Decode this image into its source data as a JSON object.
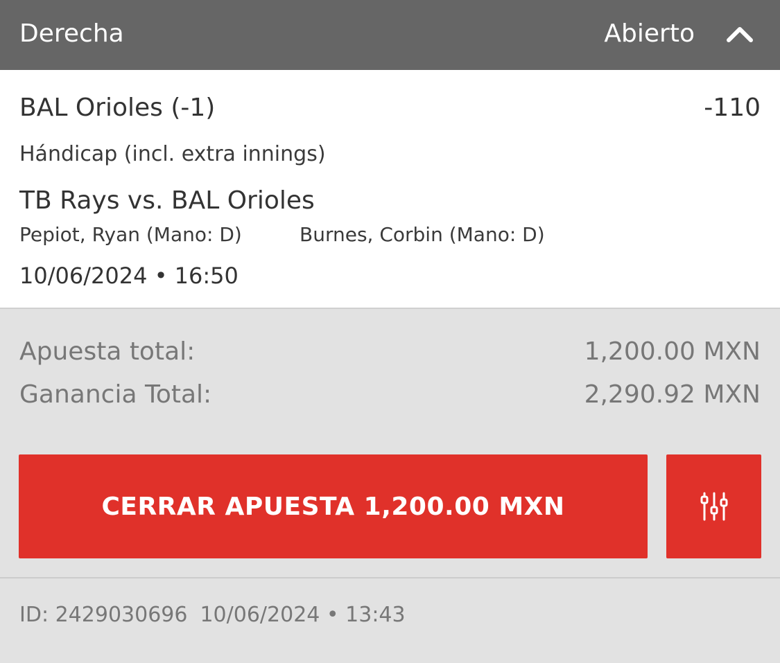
{
  "header": {
    "title": "Derecha",
    "status": "Abierto",
    "toggle_icon": "chevron-up-icon",
    "background": "#666666"
  },
  "selection": {
    "name": "BAL Orioles (-1)",
    "odds": "-110",
    "market": "Hándicap (incl. extra innings)",
    "event": "TB Rays vs. BAL Orioles",
    "pitcher_home": "Pepiot, Ryan (Mano: D)",
    "pitcher_away": "Burnes, Corbin (Mano: D)",
    "event_datetime": "10/06/2024 • 16:50"
  },
  "summary": {
    "stake_label": "Apuesta total:",
    "stake_value": "1,200.00 MXN",
    "win_label": "Ganancia Total:",
    "win_value": "2,290.92 MXN"
  },
  "actions": {
    "cashout_label": "CERRAR APUESTA 1,200.00 MXN",
    "settings_icon": "sliders-icon",
    "accent": "#e0312a"
  },
  "footer": {
    "id_text": "ID: 2429030696",
    "placed_datetime": "10/06/2024 • 13:43"
  }
}
